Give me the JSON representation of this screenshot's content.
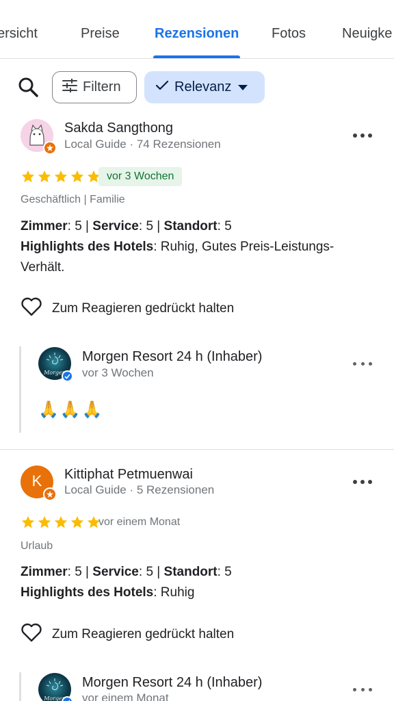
{
  "tabs": [
    {
      "label": "Übersicht",
      "display": "ersicht"
    },
    {
      "label": "Preise"
    },
    {
      "label": "Rezensionen",
      "active": true
    },
    {
      "label": "Fotos"
    },
    {
      "label": "Neuigkeiten",
      "display": "Neuigke"
    }
  ],
  "filters": {
    "search_icon": "search-icon",
    "filter_label": "Filtern",
    "sort_label": "Relevanz"
  },
  "reviews": [
    {
      "author": "Sakda Sangthong",
      "meta": "Local Guide · 74 Rezensionen",
      "rating": 5,
      "time": "vor 3 Wochen",
      "time_is_new": true,
      "trip": "Geschäftlich  |  Familie",
      "ratings_line": {
        "k1": "Zimmer",
        "v1": ": 5 | ",
        "k2": "Service",
        "v2": ": 5 | ",
        "k3": "Standort",
        "v3": ": 5"
      },
      "highlights_key": "Highlights des Hotels",
      "highlights_val": ": Ruhig, Gutes Preis-Leistungs-",
      "highlights_val2": "Verhält.",
      "react_label": "Zum Reagieren gedrückt halten",
      "owner": {
        "name": "Morgen Resort 24 h (Inhaber)",
        "time": "vor 3 Wochen",
        "text": "🙏🙏🙏",
        "logo_text": "Morgen"
      }
    },
    {
      "author": "Kittiphat Petmuenwai",
      "initial": "K",
      "meta": "Local Guide · 5 Rezensionen",
      "rating": 5,
      "time": "vor einem Monat",
      "time_is_new": false,
      "trip": "Urlaub",
      "ratings_line": {
        "k1": "Zimmer",
        "v1": ": 5 | ",
        "k2": "Service",
        "v2": ": 5 | ",
        "k3": "Standort",
        "v3": ": 5"
      },
      "highlights_key": "Highlights des Hotels",
      "highlights_val": ": Ruhig",
      "react_label": "Zum Reagieren gedrückt halten",
      "owner": {
        "name": "Morgen Resort 24 h (Inhaber)",
        "time": "vor einem Monat",
        "logo_text": "Morgen"
      }
    }
  ],
  "colors": {
    "accent": "#1a73e8",
    "star": "#fbbc04",
    "new_badge_bg": "#e6f4ea",
    "new_badge_text": "#137333",
    "local_guide_badge": "#e8710a",
    "avatar_k": "#e8710a"
  }
}
